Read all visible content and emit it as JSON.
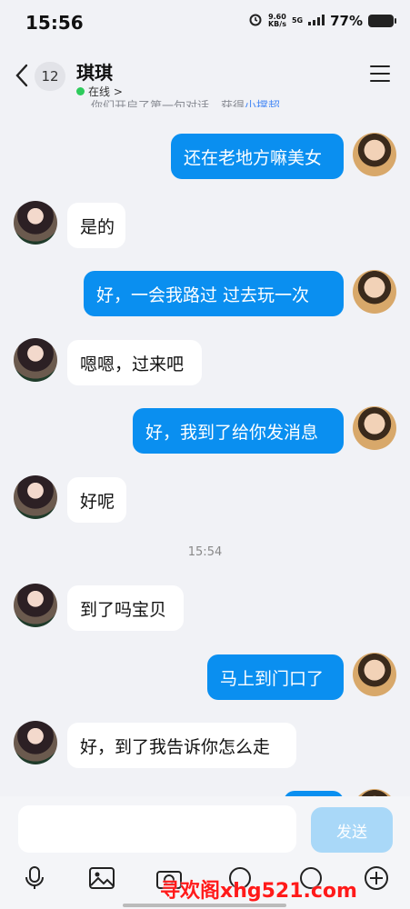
{
  "status_bar": {
    "time": "15:56",
    "net_speed_value": "9.60",
    "net_speed_unit": "KB/s",
    "network": "5G",
    "battery": "77%"
  },
  "header": {
    "unread_count": "12",
    "contact_name": "琪琪",
    "status": "在线 >"
  },
  "system_note": {
    "text": "你们开启了第一句对话，获得",
    "highlight": "小撑超"
  },
  "messages": [
    {
      "side": "out",
      "text": "还在老地方嘛美女"
    },
    {
      "side": "in",
      "text": "是的"
    },
    {
      "side": "out",
      "text": "好，一会我路过  过去玩一次"
    },
    {
      "side": "in",
      "text": "嗯嗯，过来吧"
    },
    {
      "side": "out",
      "text": "好，我到了给你发消息"
    },
    {
      "side": "in",
      "text": "好呢"
    },
    {
      "side": "in",
      "text": "到了吗宝贝"
    },
    {
      "side": "out",
      "text": "马上到门口了"
    },
    {
      "side": "in",
      "text": "好，到了我告诉你怎么走"
    }
  ],
  "timestamp": "15:54",
  "composer": {
    "send_label": "发送"
  },
  "watermark": "寻欢阁xhg521.com",
  "colors": {
    "outgoing_bubble": "#0a8ff0",
    "incoming_bubble": "#ffffff",
    "online_dot": "#2ecb5c",
    "send_button": "#a9d8f8"
  }
}
